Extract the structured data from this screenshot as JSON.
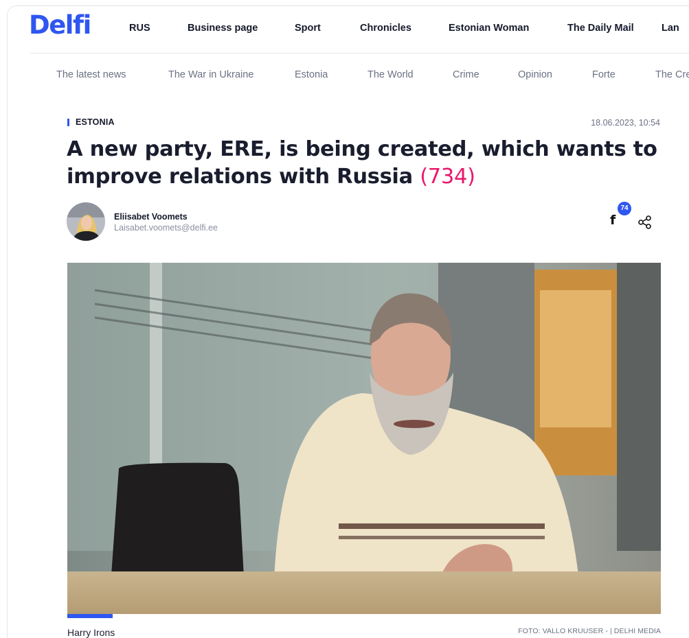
{
  "site": {
    "logo": "Delfi",
    "brand_color": "#2f56f0",
    "accent_color": "#e8196b"
  },
  "top_nav": [
    "RUS",
    "Business page",
    "Sport",
    "Chronicles",
    "Estonian Woman",
    "The Daily Mail",
    "Lan"
  ],
  "section_nav": [
    "The latest news",
    "The War in Ukraine",
    "Estonia",
    "The World",
    "Crime",
    "Opinion",
    "Forte",
    "The Cre"
  ],
  "article": {
    "category": "ESTONIA",
    "date": "18.06.2023, 10:54",
    "headline": "A new party, ERE, is being created, which wants to improve relations with Russia",
    "comments_count": "(734)",
    "author_name": "Eliisabet Voomets",
    "author_email": "Laisabet.voomets@delfi.ee",
    "facebook_shares": "74",
    "share_icons": [
      "facebook-icon",
      "share-icon"
    ],
    "image_caption": "Harry Irons",
    "image_credit": "FOTO: VALLO KRUUSER - | DELHI MEDIA"
  }
}
